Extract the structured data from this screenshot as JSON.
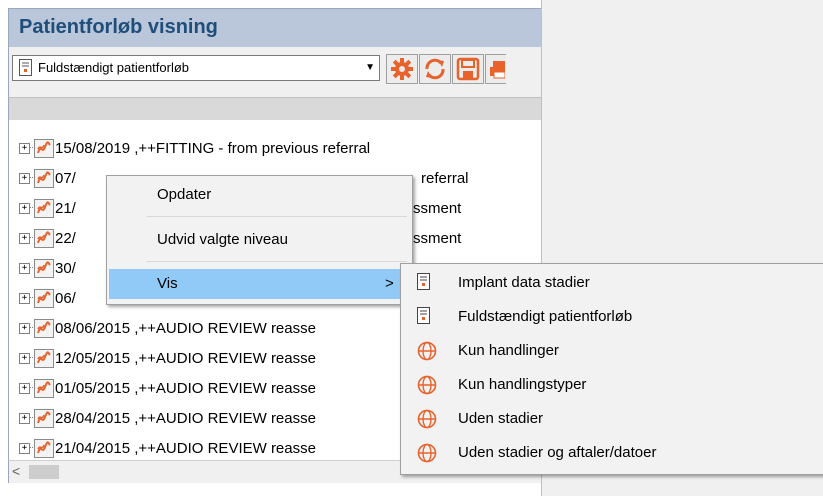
{
  "panel": {
    "title": "Patientforløb visning",
    "combo_value": "Fuldstændigt patientforløb",
    "toolbar_buttons": [
      "gear-icon",
      "refresh-icon",
      "save-icon",
      "print-icon"
    ]
  },
  "tree": {
    "rows": [
      {
        "label": "15/08/2019 ,++FITTING - from previous referral"
      },
      {
        "label": "07/",
        "tail": "referral"
      },
      {
        "label": "21/",
        "tail": "ssment"
      },
      {
        "label": "22/",
        "tail": "ssment"
      },
      {
        "label": "30/"
      },
      {
        "label": "06/"
      },
      {
        "label": "08/06/2015 ,++AUDIO REVIEW reasse"
      },
      {
        "label": "12/05/2015 ,++AUDIO REVIEW reasse"
      },
      {
        "label": "01/05/2015 ,++AUDIO REVIEW reasse"
      },
      {
        "label": "28/04/2015 ,++AUDIO REVIEW reasse"
      },
      {
        "label": "21/04/2015 ,++AUDIO REVIEW reasse"
      }
    ]
  },
  "context_menu": {
    "items": [
      "Opdater",
      "Udvid valgte niveau",
      "Vis"
    ],
    "submenu_arrow": ">"
  },
  "submenu": {
    "items": [
      {
        "label": "Implant data stadier",
        "icon": "document-icon"
      },
      {
        "label": "Fuldstændigt patientforløb",
        "icon": "document-icon"
      },
      {
        "label": "Kun handlinger",
        "icon": "globe-icon"
      },
      {
        "label": "Kun handlingstyper",
        "icon": "globe-icon"
      },
      {
        "label": "Uden stadier",
        "icon": "globe-icon"
      },
      {
        "label": "Uden stadier og aftaler/datoer",
        "icon": "globe-icon"
      }
    ]
  },
  "scrollbar": {
    "left_arrow": "<"
  },
  "colors": {
    "title_bg": "#bac6d9",
    "title_text": "#1f4e7a",
    "highlight": "#91c9f7",
    "accent": "#e8622c"
  }
}
